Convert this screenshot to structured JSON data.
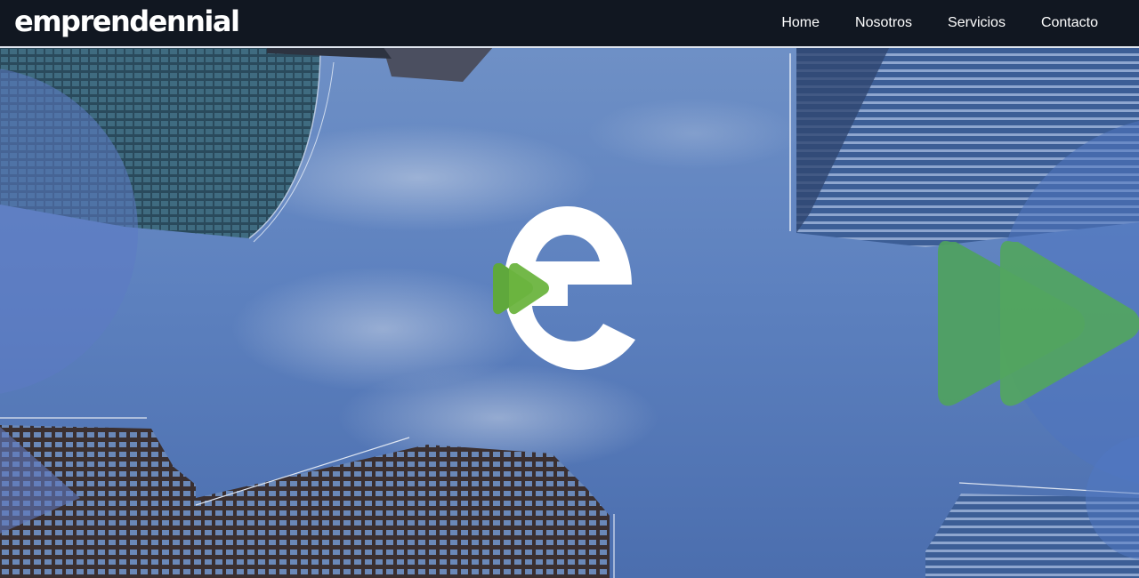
{
  "header": {
    "logo_text": "emprendennial",
    "nav": [
      {
        "label": "Home"
      },
      {
        "label": "Nosotros"
      },
      {
        "label": "Servicios"
      },
      {
        "label": "Contacto"
      }
    ]
  },
  "hero": {
    "logo_icon": "emprendennial-e-play-logo",
    "decorative_icon": "double-play-arrow-icon"
  },
  "colors": {
    "header_bg": "#0e121a",
    "sky": "#5a7fbf",
    "brand_green": "#5fa83c",
    "deco_green": "#4fa25e",
    "building_dark": "#3b3f4e"
  }
}
